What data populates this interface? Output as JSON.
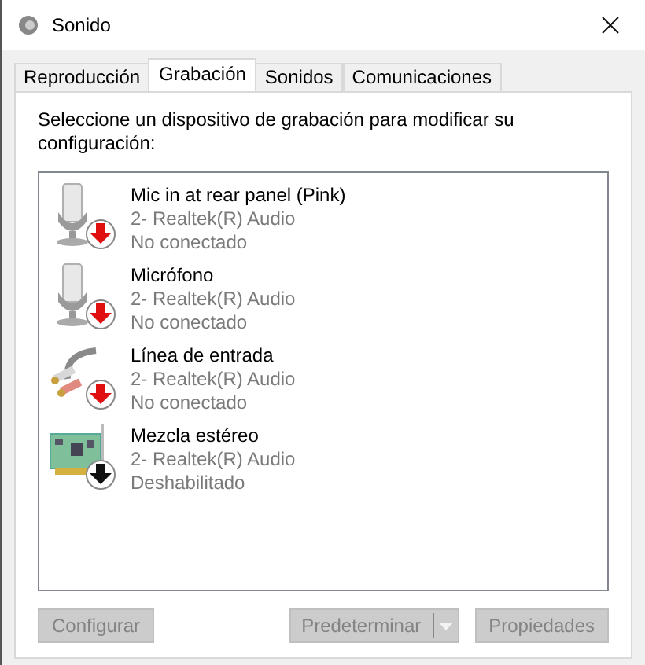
{
  "window": {
    "title": "Sonido"
  },
  "tabs": [
    {
      "label": "Reproducción",
      "selected": false
    },
    {
      "label": "Grabación",
      "selected": true
    },
    {
      "label": "Sonidos",
      "selected": false
    },
    {
      "label": "Comunicaciones",
      "selected": false
    }
  ],
  "instruction": "Seleccione un dispositivo de grabación para modificar su configuración:",
  "devices": [
    {
      "kind": "microphone",
      "name": "Mic in at rear panel (Pink)",
      "driver": "2- Realtek(R) Audio",
      "status": "No conectado",
      "disabled": false
    },
    {
      "kind": "microphone",
      "name": "Micrófono",
      "driver": "2- Realtek(R) Audio",
      "status": "No conectado",
      "disabled": false
    },
    {
      "kind": "line",
      "name": "Línea de entrada",
      "driver": "2- Realtek(R) Audio",
      "status": "No conectado",
      "disabled": false
    },
    {
      "kind": "card",
      "name": "Mezcla estéreo",
      "driver": "2- Realtek(R) Audio",
      "status": "Deshabilitado",
      "disabled": true
    }
  ],
  "buttons": [
    {
      "label": "Configurar",
      "kind": "plain",
      "disabled": true
    },
    {
      "label": "Predeterminar",
      "kind": "split",
      "disabled": true
    },
    {
      "label": "Propiedades",
      "kind": "plain",
      "disabled": true
    }
  ]
}
